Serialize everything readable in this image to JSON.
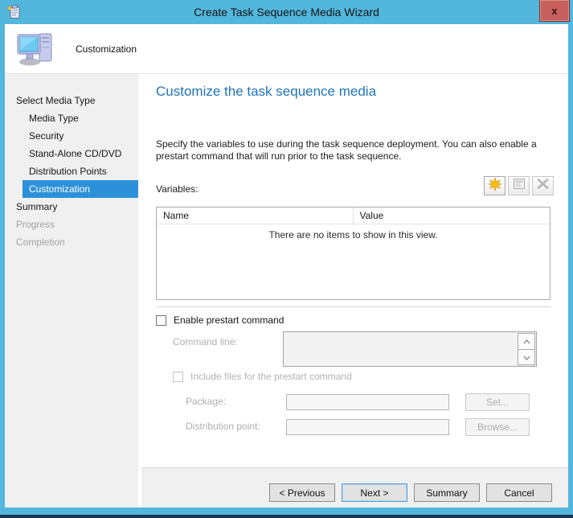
{
  "window": {
    "title": "Create Task Sequence Media Wizard",
    "close_glyph": "x"
  },
  "header": {
    "step_title": "Customization"
  },
  "sidebar": {
    "items": [
      {
        "label": "Select Media Type",
        "level": 0,
        "state": "normal"
      },
      {
        "label": "Media Type",
        "level": 1,
        "state": "normal"
      },
      {
        "label": "Security",
        "level": 1,
        "state": "normal"
      },
      {
        "label": "Stand-Alone CD/DVD",
        "level": 1,
        "state": "normal"
      },
      {
        "label": "Distribution Points",
        "level": 1,
        "state": "normal"
      },
      {
        "label": "Customization",
        "level": 1,
        "state": "selected"
      },
      {
        "label": "Summary",
        "level": 0,
        "state": "normal"
      },
      {
        "label": "Progress",
        "level": 0,
        "state": "disabled"
      },
      {
        "label": "Completion",
        "level": 0,
        "state": "disabled"
      }
    ]
  },
  "main": {
    "heading": "Customize the task sequence media",
    "description": "Specify the variables to use during the task sequence deployment. You can also enable a prestart command that will run prior to the task sequence.",
    "variables": {
      "label": "Variables:",
      "columns": [
        "Name",
        "Value"
      ],
      "empty_text": "There are no items to show in this view.",
      "toolbar": [
        {
          "icon": "new-star-icon",
          "enabled": true
        },
        {
          "icon": "properties-icon",
          "enabled": false
        },
        {
          "icon": "delete-x-icon",
          "enabled": false
        }
      ]
    },
    "prestart": {
      "enable_label": "Enable prestart command",
      "enable_checked": false,
      "command_line_label": "Command line:",
      "command_line_value": "",
      "include_files_label": "Include files for the prestart command",
      "include_files_checked": false,
      "package_label": "Package:",
      "package_value": "",
      "set_button": "Set...",
      "distribution_point_label": "Distribution point:",
      "distribution_point_value": "",
      "browse_button": "Browse..."
    }
  },
  "footer": {
    "buttons": [
      {
        "label": "< Previous",
        "focused": false
      },
      {
        "label": "Next >",
        "focused": true
      },
      {
        "label": "Summary",
        "focused": false
      },
      {
        "label": "Cancel",
        "focused": false
      }
    ]
  },
  "colors": {
    "titlebar_blue": "#53B6DC",
    "selected_step_blue": "#2D91DA",
    "heading_blue": "#2173B9",
    "close_button_red": "#C7605C",
    "new_star_yellow": "#FFC20E"
  }
}
